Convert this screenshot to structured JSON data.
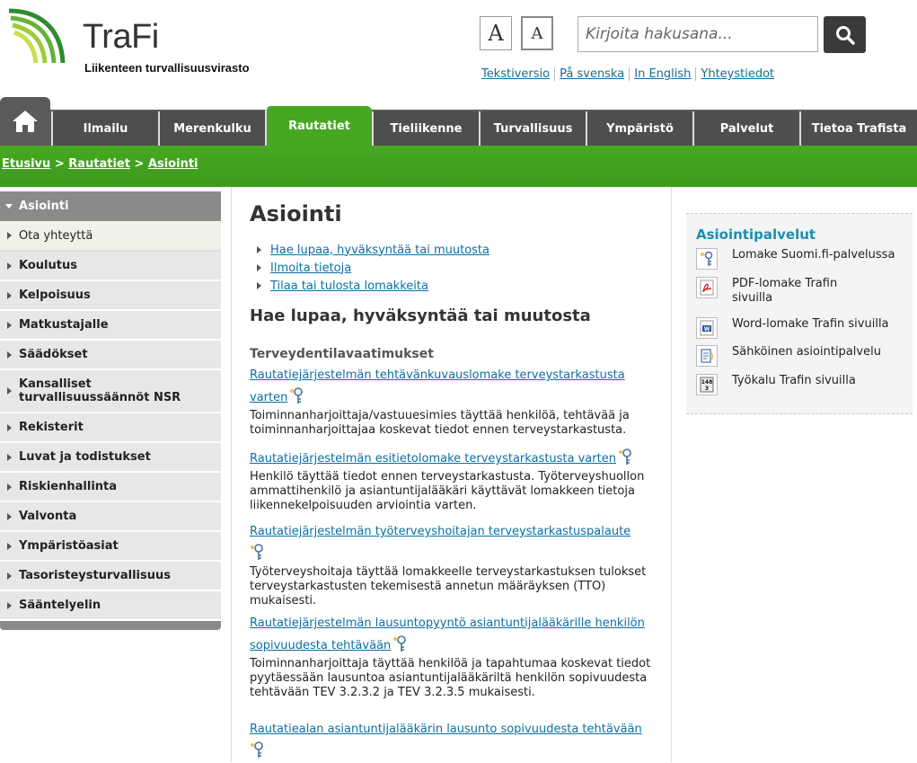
{
  "header": {
    "brand": "TraFi",
    "subtitle": "Liikenteen turvallisuusvirasto",
    "font_large": "A",
    "font_small": "A",
    "search_placeholder": "Kirjoita hakusana...",
    "links": [
      "Tekstiversio",
      "På svenska",
      "In English",
      "Yhteystiedot"
    ]
  },
  "nav": {
    "tabs": [
      "Ilmailu",
      "Merenkulku",
      "Rautatiet",
      "Tieliikenne",
      "Turvallisuus",
      "Ympäristö",
      "Palvelut",
      "Tietoa Trafista"
    ],
    "active": "Rautatiet"
  },
  "breadcrumb": [
    "Etusivu",
    "Rautatiet",
    "Asiointi"
  ],
  "sidebar": {
    "head": "Asiointi",
    "sub": "Ota yhteyttä",
    "items": [
      "Koulutus",
      "Kelpoisuus",
      "Matkustajalle",
      "Säädökset",
      "Kansalliset turvallisuussäännöt NSR",
      "Rekisterit",
      "Luvat ja todistukset",
      "Riskienhallinta",
      "Valvonta",
      "Ympäristöasiat",
      "Tasoristeysturvallisuus",
      "Sääntelyelin"
    ]
  },
  "main": {
    "title": "Asiointi",
    "toc": [
      "Hae lupaa, hyväksyntää tai muutosta",
      "Ilmoita tietoja",
      "Tilaa tai tulosta lomakkeita"
    ],
    "section_title": "Hae lupaa, hyväksyntää tai muutosta",
    "subsection": "Terveydentilavaatimukset",
    "entries": [
      {
        "link": "Rautatiejärjestelmän tehtävänkuvauslomake terveystarkastusta varten",
        "text": "Toiminnanharjoittaja/vastuuesimies täyttää henkilöä, tehtävää ja toiminnanharjoittajaa koskevat tiedot ennen terveystarkastusta."
      },
      {
        "link": "Rautatiejärjestelmän esitietolomake terveystarkastusta varten",
        "text": "Henkilö täyttää tiedot ennen terveystarkastusta. Työterveyshuollon ammattihenkilö ja asiantuntijalääkäri käyttävät lomakkeen tietoja liikennekelpoisuuden arviointia varten."
      },
      {
        "link": "Rautatiejärjestelmän työterveyshoitajan terveystarkastuspalaute",
        "text": "Työterveyshoitaja täyttää lomakkeelle terveystarkastuksen tulokset terveystarkastusten tekemisestä annetun määräyksen (TTO) mukaisesti."
      },
      {
        "link": "Rautatiejärjestelmän lausuntopyyntö asiantuntijalääkärille henkilön sopivuudesta tehtävään",
        "text": "Toiminnanharjoittaja täyttää henkilöä ja tapahtumaa koskevat tiedot pyytäessään lausuntoa asiantuntijalääkäriltä henkilön sopivuudesta tehtävään TEV 3.2.3.2 ja TEV 3.2.3.5 mukaisesti."
      },
      {
        "link": "Rautatiealan asiantuntijalääkärin lausunto sopivuudesta tehtävään",
        "text": ""
      }
    ]
  },
  "legend": {
    "title": "Asiointipalvelut",
    "items": [
      {
        "icon": "key-icon",
        "label": "Lomake Suomi.fi-palvelussa"
      },
      {
        "icon": "pdf-icon",
        "label": "PDF-lomake Trafin sivuilla"
      },
      {
        "icon": "word-icon",
        "label": "Word-lomake Trafin sivuilla"
      },
      {
        "icon": "eservice-icon",
        "label": "Sähköinen asiointipalvelu"
      },
      {
        "icon": "calculator-icon",
        "label": "Työkalu Trafin sivuilla",
        "glyph": "148\n3"
      }
    ]
  },
  "colors": {
    "green": "#46a822",
    "nav": "#4e4e4e",
    "link": "#0b6fa4",
    "legend_title": "#1a8fae"
  }
}
